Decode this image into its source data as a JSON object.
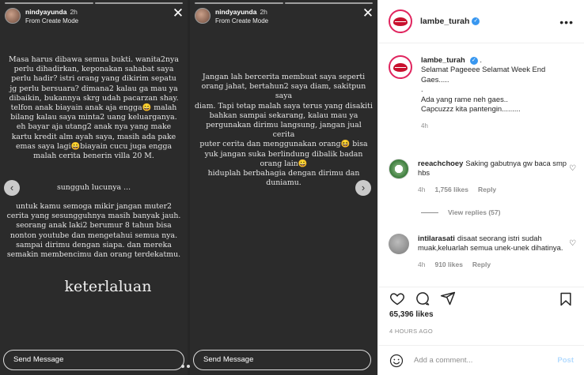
{
  "stories": [
    {
      "username": "nindyayunda",
      "time": "2h",
      "subtitle": "From Create Mode",
      "paragraphs": [
        "Masa harus dibawa semua bukti. wanita2nya\nperlu dihadirkan, keponakan sahabat saya\nperlu hadir? istri orang yang dikirim sepatu\njg perlu bersuara? dimana2 kalau ga mau ya\ndibaikin, bukannya skrg udah pacarzan shay.\ntelfon anak biayain anak aja engga😄 malah\nbilang kalau saya mintа2 uang keluarganya.\neh bayar aja utang2 anak nya yang make\nkartu kredit alm ayah saya, masih ada pake\nemas saya lagi😀biayain cucu juga engga\nmalah cerita benerin villa 20 M.",
        "sungguh lucunya ...",
        "untuk kamu semoga mikir jangan muter2\ncerita yang sesungguhnya masih banyak jauh.\nseorang anak laki2 berumur 8 tahun bisa\nnonton youtube dan mengetahui semua nya.\nsampai dirimu dengan siapa. dan mereka\nsemakin membencimu dan orang terdekatmu.",
        "keterlaluan"
      ],
      "send_placeholder": "Send Message"
    },
    {
      "username": "nindyayunda",
      "time": "2h",
      "subtitle": "From Create Mode",
      "paragraphs": [
        "Jangan lah bercerita membuat saya seperti\norang jahat, bertahun2 saya diam, sakitpun saya\ndiam. Tapi tetap malah saya terus yang disakiti\nbahkan sampai sekarang, kalau mau ya\npergunakan dirimu langsung, jangan jual cerita\nputer cerita dan menggunakan orang😆 bisa\nyuk jangan suka berlindung dibalik badan\norang lain😀\nhiduplah berbahagia dengan dirimu dan\nduniamu."
      ],
      "send_placeholder": "Send Message"
    }
  ],
  "panel": {
    "username": "lambe_turah",
    "more": "•••",
    "caption": {
      "username": "lambe_turah",
      "text": ". \nSelamat Pageeee Selamat Week End\nGaes.....\n.\nAda yang rame neh gaes..\nCapcuzzz kita pantengin.........",
      "time": "4h"
    },
    "comments": [
      {
        "username": "reeachchoey",
        "text": "Saking gabutnya gw baca smp hbs",
        "time": "4h",
        "likes": "1,756 likes",
        "reply": "Reply"
      },
      {
        "username": "intilarasati",
        "text": "disaat seorang istri sudah muak,keluarlah semua unek-unek dihatinya.",
        "time": "4h",
        "likes": "910 likes",
        "reply": "Reply"
      }
    ],
    "view_replies": "View replies (57)",
    "likes_count": "65,396 likes",
    "age": "4 HOURS AGO",
    "add_comment_placeholder": "Add a comment...",
    "post_label": "Post"
  },
  "colors": {
    "verified": "#3897f0",
    "post_disabled": "#b3dbff",
    "brand_lips": "#c8102e"
  }
}
